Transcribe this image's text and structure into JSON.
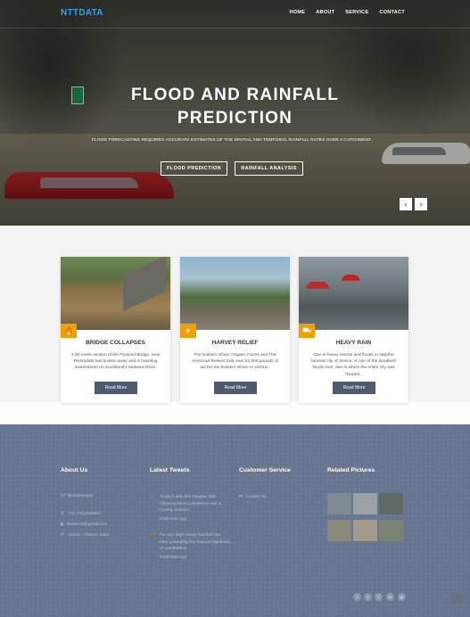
{
  "nav": {
    "logo": "NTTDATA",
    "items": [
      "HOME",
      "ABOUT",
      "SERVICE",
      "CONTACT"
    ]
  },
  "hero": {
    "title_line1": "FLOOD AND RAINFALL",
    "title_line2": "PREDICTION",
    "subtitle": "FLOOD FORECASTING REQUIRES ACCURATE ESTIMATES OF THE SPATIAL AND TEMPORAL RAINFALL RATES OVER A CATCHMENT.",
    "btn_flood": "FLOOD PREDICTION",
    "btn_rainfall": "RAINFALL ANALYSIS",
    "prev": "‹",
    "next": "›"
  },
  "cards": [
    {
      "icon": "flame-icon",
      "title": "BRIDGE COLLAPSES",
      "text": "A 50-metre section of the Pyramid Bridge, near Riversdale,has broken away and is traveling downstream on Southland's Mataura River.",
      "button": "Read More"
    },
    {
      "icon": "plane-icon",
      "title": "HARVEY RELIEF",
      "text": "The Eastern Shore Organic Farms and The American Reivies took over 22,000 pounds of aid fon the Eastern Shore to victims..",
      "button": "Read More"
    },
    {
      "icon": "truck-icon",
      "title": "HEAVY RAIN",
      "text": "Due to heavy storms and floods in Italy,the famous city of Venice, is one of the deadliest floods ever, due to which the entire city was flooded..",
      "button": "Read More"
    }
  ],
  "footer": {
    "about": {
      "title": "About Us",
      "address": "NT Bhubaneswar",
      "phone": "+91-7661989800",
      "email": "rheem76@gmail.com",
      "location": "Orissa - 751001,India"
    },
    "tweets": {
      "title": "Latest Tweets",
      "items": [
        {
          "text_lines": [
            "Today it was like Niagara falls",
            "following heavy persistent rain in",
            "County Durham"
          ],
          "time": "5 Minutes Ago"
        },
        {
          "text_lines": [
            "For two days heavy Rainfall has",
            "been pounding the Papuan highlands",
            "of Lambobbes"
          ],
          "time": "5 Minutes Ago"
        }
      ]
    },
    "service": {
      "title": "Customer Service",
      "link": "Contact Us"
    },
    "pictures": {
      "title": "Related Pictures",
      "colors": [
        "#7f8b91",
        "#9aa3a8",
        "#5e6a62",
        "#8a8a7a",
        "#a39a8c",
        "#7a8272"
      ]
    },
    "social": [
      "f",
      "v",
      "t",
      "in",
      "◎"
    ]
  }
}
